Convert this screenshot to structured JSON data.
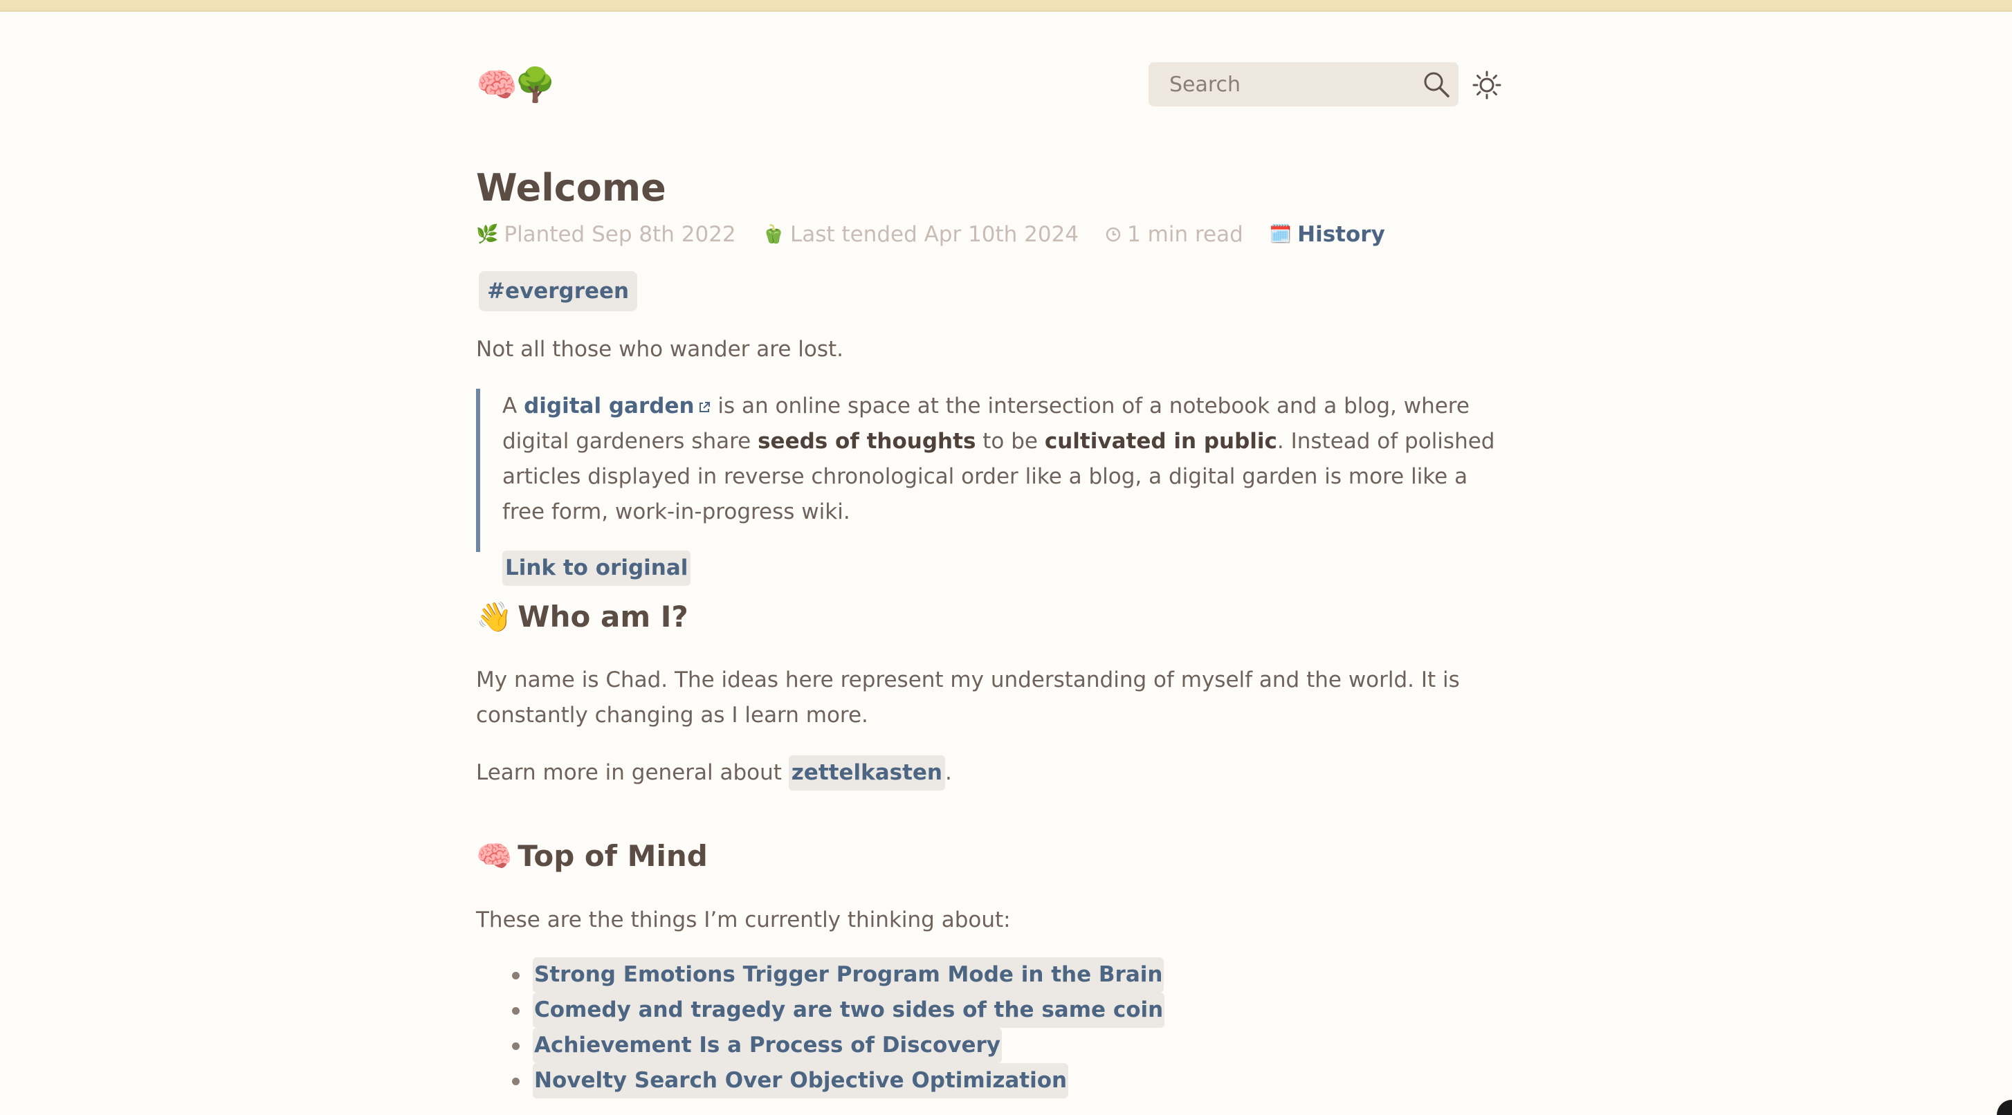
{
  "header": {
    "logo": "🧠🌳",
    "search": {
      "placeholder": "Search",
      "value": ""
    },
    "icons": {
      "search": "search-icon",
      "theme": "sun-icon"
    }
  },
  "page": {
    "title": "Welcome",
    "meta": {
      "planted_icon": "🌿",
      "planted": "Planted Sep 8th 2022",
      "tended_icon": "🫑",
      "tended": "Last tended Apr 10th 2024",
      "read_icon": "clock-icon",
      "read_time": "1 min read",
      "history_icon": "🗓️",
      "history_label": "History"
    },
    "tag": "#evergreen",
    "intro": "Not all those who wander are lost.",
    "quote": {
      "prefix": "A",
      "link_text": "digital garden",
      "text_1": "is an online space at the intersection of a notebook and a blog, where digital gardeners share",
      "bold_1": "seeds of thoughts",
      "text_2": "to be",
      "bold_2": "cultivated in public",
      "text_3": ". Instead of polished articles displayed in reverse chronological order like a blog, a digital garden is more like a free form, work-in-progress wiki.",
      "original_link": "Link to original"
    }
  },
  "who": {
    "emoji": "👋",
    "heading": "Who am I?",
    "bio": "My name is Chad. The ideas here represent my understanding of myself and the world. It is constantly changing as I learn more.",
    "learn_prefix": "Learn more in general about",
    "learn_link": "zettelkasten",
    "learn_suffix": "."
  },
  "mind": {
    "emoji": "🧠",
    "heading": "Top of Mind",
    "intro": "These are the things I’m currently thinking about:",
    "items": [
      "Strong Emotions Trigger Program Mode in the Brain",
      "Comedy and tragedy are two sides of the same coin",
      "Achievement Is a Process of Discovery",
      "Novelty Search Over Objective Optimization"
    ]
  },
  "colors": {
    "background": "#fdfcf9",
    "top_bar": "#f1e2b8",
    "link": "#4c6583",
    "text": "#6e625a",
    "heading": "#5b4c44",
    "quote_border": "#6f86a2"
  }
}
